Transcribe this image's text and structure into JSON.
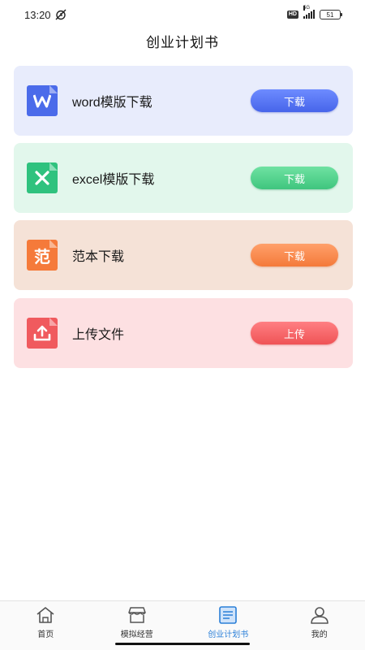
{
  "status_bar": {
    "time": "13:20",
    "network_label": "5G",
    "hd_label": "HD",
    "battery": "51"
  },
  "header": {
    "title": "创业计划书"
  },
  "cards": [
    {
      "label": "word模版下载",
      "button": "下载",
      "icon": "word-file-icon",
      "icon_glyph": "W",
      "color": "#4b6bea"
    },
    {
      "label": "excel模版下载",
      "button": "下载",
      "icon": "excel-file-icon",
      "icon_glyph": "X",
      "color": "#2fc27e"
    },
    {
      "label": "范本下载",
      "button": "下载",
      "icon": "template-file-icon",
      "icon_glyph": "范",
      "color": "#f57a3a"
    },
    {
      "label": "上传文件",
      "button": "上传",
      "icon": "upload-file-icon",
      "icon_glyph": "upload",
      "color": "#f05a5e"
    }
  ],
  "bottom_nav": {
    "items": [
      {
        "label": "首页",
        "icon": "home-icon",
        "active": false
      },
      {
        "label": "模拟经营",
        "icon": "store-icon",
        "active": false
      },
      {
        "label": "创业计划书",
        "icon": "document-icon",
        "active": true
      },
      {
        "label": "我的",
        "icon": "user-icon",
        "active": false
      }
    ],
    "active_color": "#2a7fd8"
  }
}
